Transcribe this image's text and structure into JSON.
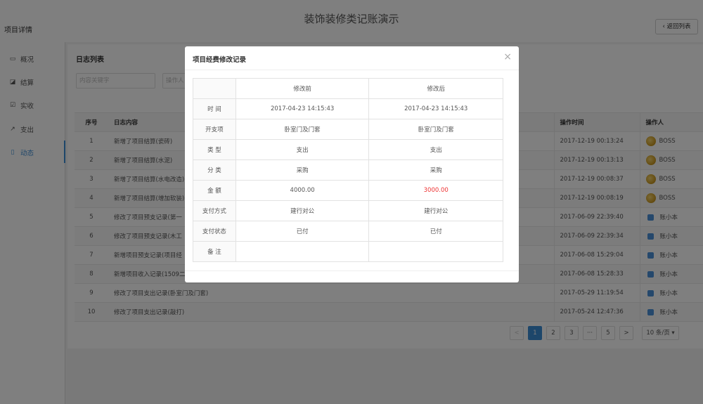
{
  "app": {
    "title": "装饰装修类记账演示",
    "page_label": "项目详情",
    "back_label": "返回列表"
  },
  "sidebar": {
    "items": [
      {
        "icon": "monitor-icon",
        "glyph": "▭",
        "label": "概况"
      },
      {
        "icon": "edit-icon",
        "glyph": "◪",
        "label": "结算"
      },
      {
        "icon": "check-icon",
        "glyph": "☑",
        "label": "实收"
      },
      {
        "icon": "share-icon",
        "glyph": "↗",
        "label": "支出"
      },
      {
        "icon": "doc-icon",
        "glyph": "▯",
        "label": "动态"
      }
    ],
    "active_index": 4
  },
  "panel": {
    "title": "日志列表",
    "search_placeholder": "内容关键字",
    "operator_placeholder": "操作人"
  },
  "table": {
    "headers": {
      "no": "序号",
      "content": "日志内容",
      "time": "操作时间",
      "operator": "操作人"
    },
    "rows": [
      {
        "no": "1",
        "content": "新增了项目结算(瓷砖)",
        "time": "2017-12-19 00:13:24",
        "operator": "BOSS",
        "avatar": "boss"
      },
      {
        "no": "2",
        "content": "新增了项目结算(水泥)",
        "time": "2017-12-19 00:13:13",
        "operator": "BOSS",
        "avatar": "boss"
      },
      {
        "no": "3",
        "content": "新增了项目结算(水电改造)",
        "time": "2017-12-19 00:08:37",
        "operator": "BOSS",
        "avatar": "boss"
      },
      {
        "no": "4",
        "content": "新增了项目结算(增加软装)",
        "time": "2017-12-19 00:08:19",
        "operator": "BOSS",
        "avatar": "boss"
      },
      {
        "no": "5",
        "content": "修改了项目预支记录(第一",
        "time": "2017-06-09 22:39:40",
        "operator": "账小本",
        "avatar": "user"
      },
      {
        "no": "6",
        "content": "修改了项目预支记录(木工",
        "time": "2017-06-09 22:39:34",
        "operator": "账小本",
        "avatar": "user"
      },
      {
        "no": "7",
        "content": "新增项目预支记录(项目经",
        "time": "2017-06-08 15:29:04",
        "operator": "账小本",
        "avatar": "user"
      },
      {
        "no": "8",
        "content": "新增项目收入记录(1509二",
        "time": "2017-06-08 15:28:33",
        "operator": "账小本",
        "avatar": "user"
      },
      {
        "no": "9",
        "content": "修改了项目支出记录(卧室门及门套)",
        "time": "2017-05-29 11:19:54",
        "operator": "账小本",
        "avatar": "user"
      },
      {
        "no": "10",
        "content": "修改了项目支出记录(敲打)",
        "time": "2017-05-24 12:47:36",
        "operator": "账小本",
        "avatar": "user"
      }
    ]
  },
  "pagination": {
    "prev": "<",
    "pages": [
      "1",
      "2",
      "3",
      "···",
      "5"
    ],
    "active_page": "1",
    "next": ">",
    "page_size": "10 条/页"
  },
  "modal": {
    "title": "项目经费修改记录",
    "close": "×",
    "headers": {
      "before": "修改前",
      "after": "修改后"
    },
    "rows": [
      {
        "label": "时 间",
        "before": "2017-04-23 14:15:43",
        "after": "2017-04-23 14:15:43",
        "changed": false
      },
      {
        "label": "开支项",
        "before": "卧室门及门套",
        "after": "卧室门及门套",
        "changed": false
      },
      {
        "label": "类 型",
        "before": "支出",
        "after": "支出",
        "changed": false
      },
      {
        "label": "分 类",
        "before": "采购",
        "after": "采购",
        "changed": false
      },
      {
        "label": "金 额",
        "before": "4000.00",
        "after": "3000.00",
        "changed": true
      },
      {
        "label": "支付方式",
        "before": "建行对公",
        "after": "建行对公",
        "changed": false
      },
      {
        "label": "支付状态",
        "before": "已付",
        "after": "已付",
        "changed": false
      },
      {
        "label": "备 注",
        "before": "",
        "after": "",
        "changed": false
      }
    ]
  },
  "colors": {
    "accent": "#3b8dd4",
    "changed": "#e33333",
    "overlay": "rgba(0,0,0,0.5)"
  }
}
